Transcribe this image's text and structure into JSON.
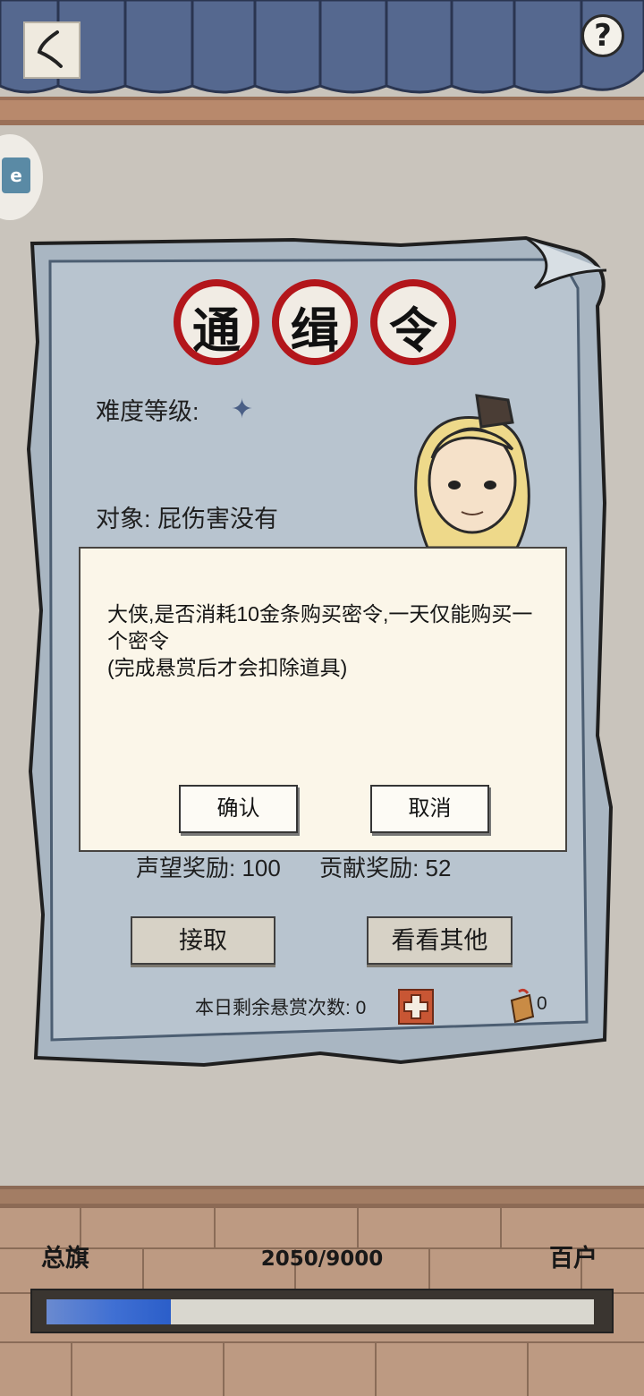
{
  "header": {
    "help_label": "?",
    "side_tab_label": "e"
  },
  "notice": {
    "stamp_chars": [
      "通",
      "缉",
      "令"
    ],
    "difficulty_label": "难度等级:",
    "difficulty_star": "✦",
    "target_line": "对象: 屁伤害没有",
    "reputation_reward": "声望奖励: 100",
    "contribution_reward": "贡献奖励: 52",
    "accept_button": "接取",
    "others_button": "看看其他",
    "remaining_label": "本日剩余悬赏次数: 0",
    "token_count": "0"
  },
  "dialog": {
    "message_line1": "大侠,是否消耗10金条购买密令,一天仅能购买一个密令",
    "message_line2": "(完成悬赏后才会扣除道具)",
    "confirm_label": "确认",
    "cancel_label": "取消"
  },
  "rank": {
    "current": "总旗",
    "next": "百户",
    "progress_text": "2050/9000",
    "progress_value": 2050,
    "progress_max": 9000
  },
  "colors": {
    "progress_fill": "#3f6fd3",
    "stamp_red": "#b3161b",
    "accent_star": "#4a5f86"
  }
}
